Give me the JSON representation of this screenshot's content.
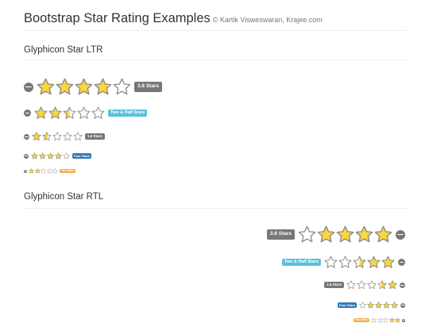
{
  "page": {
    "title": "Bootstrap Star Rating Examples",
    "credit": "© Kartik Visweswaran, Krajee.com"
  },
  "sections": {
    "ltr_title": "Glyphicon Star LTR",
    "rtl_title": "Glyphicon Star RTL"
  },
  "colors": {
    "star_fill": "#fad63f",
    "star_stroke": "#8a8a8a",
    "star_empty": "#ffffff",
    "clear_icon": "#777777",
    "badge_grey": "#777777",
    "badge_info": "#5bc0de",
    "badge_primary": "#337ab7",
    "badge_warning": "#f0ad4e"
  },
  "ltr_ratings": [
    {
      "stars": 3.8,
      "max": 5,
      "caption": "3.8 Stars",
      "badge_color": "#777777",
      "size": "xl"
    },
    {
      "stars": 2.5,
      "max": 5,
      "caption": "Two & Half Stars",
      "badge_color": "#5bc0de",
      "size": "lg"
    },
    {
      "stars": 1.6,
      "max": 5,
      "caption": "1.6 Stars",
      "badge_color": "#777777",
      "size": "md"
    },
    {
      "stars": 4,
      "max": 5,
      "caption": "Four Stars",
      "badge_color": "#337ab7",
      "size": "sm"
    },
    {
      "stars": 2,
      "max": 5,
      "caption": "Two Stars",
      "badge_color": "#f0ad4e",
      "size": "xs"
    }
  ],
  "rtl_ratings": [
    {
      "stars": 3.8,
      "max": 5,
      "caption": "3.8 Stars",
      "badge_color": "#777777",
      "size": "xl"
    },
    {
      "stars": 2.5,
      "max": 5,
      "caption": "Two & Half Stars",
      "badge_color": "#5bc0de",
      "size": "lg"
    },
    {
      "stars": 1.6,
      "max": 5,
      "caption": "1.6 Stars",
      "badge_color": "#777777",
      "size": "md"
    },
    {
      "stars": 4,
      "max": 5,
      "caption": "Four Stars",
      "badge_color": "#337ab7",
      "size": "sm"
    },
    {
      "stars": 2,
      "max": 5,
      "caption": "Two Stars",
      "badge_color": "#f0ad4e",
      "size": "xs"
    }
  ]
}
